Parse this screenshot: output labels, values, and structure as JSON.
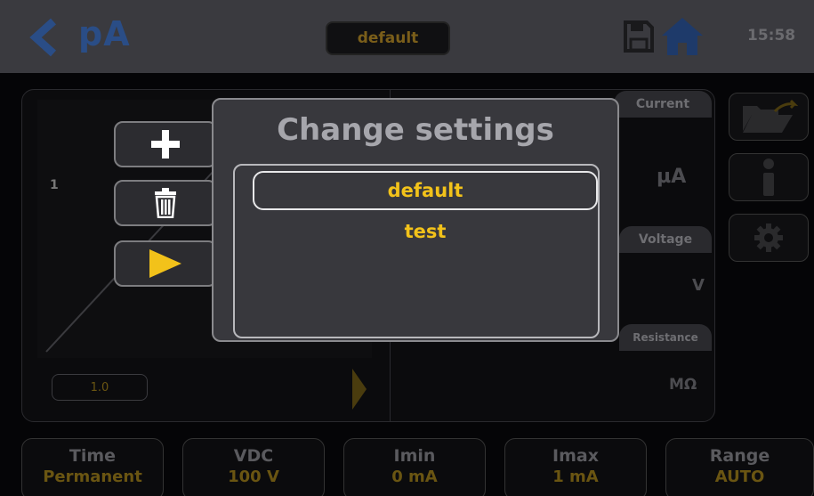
{
  "header": {
    "title": "pA",
    "file_name": "default",
    "clock": "15:58"
  },
  "graph": {
    "axis_value": "1",
    "scale_value": "1.0"
  },
  "measures": {
    "current_label": "Current",
    "current_unit": "µA",
    "voltage_label": "Voltage",
    "voltage_unit": "V",
    "resistance_label": "Resistance",
    "resistance_unit": "MΩ"
  },
  "params": [
    {
      "label": "Time",
      "value": "Permanent"
    },
    {
      "label": "VDC",
      "value": "100 V"
    },
    {
      "label": "Imin",
      "value": "0 mA"
    },
    {
      "label": "Imax",
      "value": "1 mA"
    },
    {
      "label": "Range",
      "value": "AUTO"
    }
  ],
  "modal": {
    "title": "Change settings",
    "items": [
      {
        "label": "default",
        "selected": true
      },
      {
        "label": "test",
        "selected": false
      }
    ]
  },
  "colors": {
    "accent_blue": "#2a4d86",
    "value_yellow": "#f2c21a"
  }
}
